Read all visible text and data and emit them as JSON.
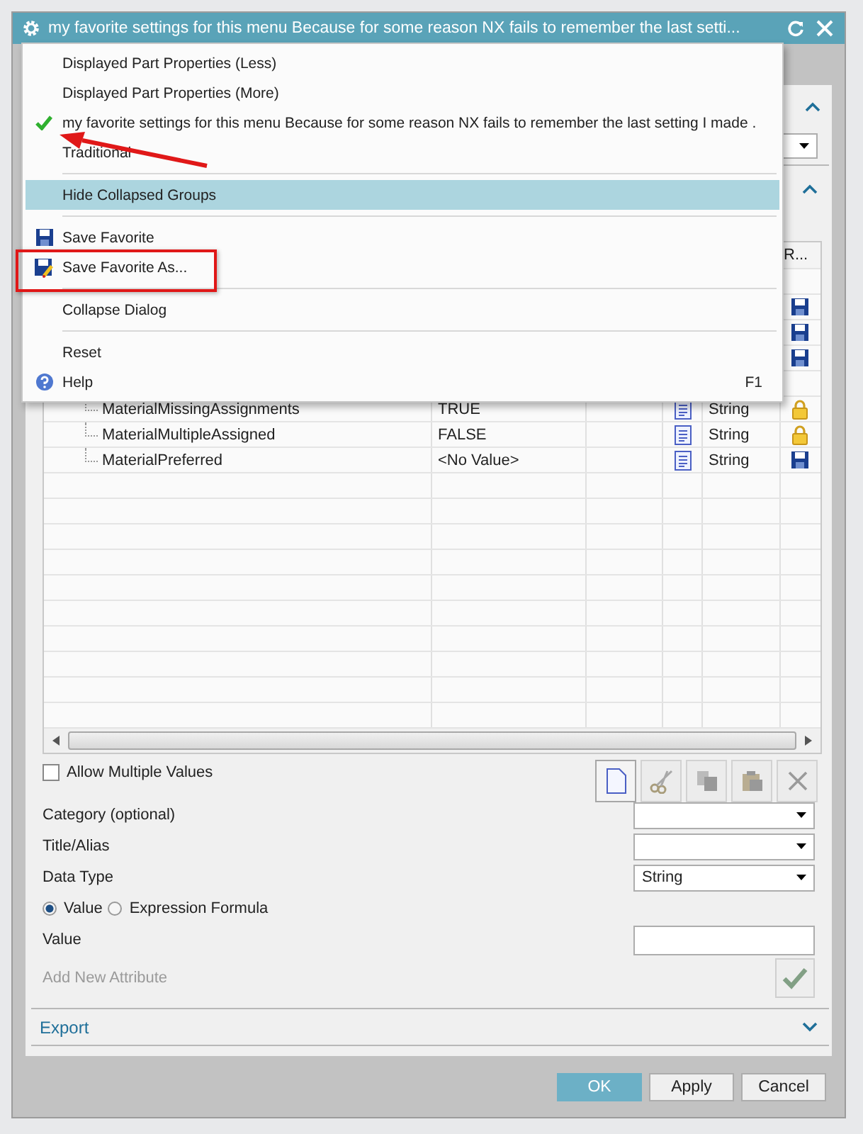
{
  "window": {
    "title": "my favorite settings for this menu Because for some reason NX fails to remember the last setti..."
  },
  "table": {
    "last_column_header": "R...",
    "rows": [
      {
        "kind": "blank"
      },
      {
        "kind": "saved"
      },
      {
        "kind": "saved"
      },
      {
        "kind": "saved"
      },
      {
        "kind": "blank"
      },
      {
        "kind": "locked",
        "name": "MaterialMissingAssignments",
        "value": "TRUE",
        "type": "String"
      },
      {
        "kind": "locked",
        "name": "MaterialMultipleAssigned",
        "value": "FALSE",
        "type": "String"
      },
      {
        "kind": "saved",
        "name": "MaterialPreferred",
        "value": "<No Value>",
        "type": "String"
      }
    ]
  },
  "allow_multiple": {
    "label": "Allow Multiple Values",
    "checked": false
  },
  "toolbar_buttons": [
    {
      "disabled": false
    },
    {
      "disabled": true
    },
    {
      "disabled": true
    },
    {
      "disabled": true
    },
    {
      "disabled": true
    }
  ],
  "fields": [
    {
      "label": "Category (optional)"
    },
    {
      "label": "Title/Alias"
    },
    {
      "label": "Data Type",
      "value": "String"
    }
  ],
  "radios": [
    {
      "label": "Value",
      "selected": true
    },
    {
      "label": "Expression Formula",
      "selected": false
    }
  ],
  "value_field": {
    "label": "Value"
  },
  "add_attribute": {
    "label": "Add New Attribute",
    "disabled": true
  },
  "export_section": {
    "title": "Export",
    "expanded": false
  },
  "buttons": [
    {
      "label": "OK",
      "kind": "primary"
    },
    {
      "label": "Apply",
      "kind": "normal"
    },
    {
      "label": "Cancel",
      "kind": "normal"
    }
  ],
  "menu": {
    "items": [
      {
        "kind": "item",
        "label": "Displayed Part Properties (Less)",
        "checked": false,
        "highlighted": false
      },
      {
        "kind": "item",
        "label": "Displayed Part Properties (More)",
        "checked": false,
        "highlighted": false
      },
      {
        "kind": "item",
        "label": "my favorite settings for this menu Because for some reason NX fails to remember the last setting I made .",
        "checked": true,
        "highlighted": false
      },
      {
        "kind": "item",
        "label": "Traditional",
        "checked": false,
        "highlighted": false
      },
      {
        "kind": "separator"
      },
      {
        "kind": "item",
        "label": "Hide Collapsed Groups",
        "checked": false,
        "highlighted": true
      },
      {
        "kind": "separator"
      },
      {
        "kind": "save",
        "label": "Save Favorite",
        "checked": false,
        "highlighted": false
      },
      {
        "kind": "save-as",
        "label": "Save Favorite As...",
        "checked": false,
        "highlighted": false
      },
      {
        "kind": "separator"
      },
      {
        "kind": "item",
        "label": "Collapse Dialog",
        "checked": false,
        "highlighted": false
      },
      {
        "kind": "separator"
      },
      {
        "kind": "item",
        "label": "Reset",
        "checked": false,
        "highlighted": false
      },
      {
        "kind": "help",
        "label": "Help",
        "shortcut": "F1",
        "checked": false,
        "highlighted": false
      }
    ]
  }
}
